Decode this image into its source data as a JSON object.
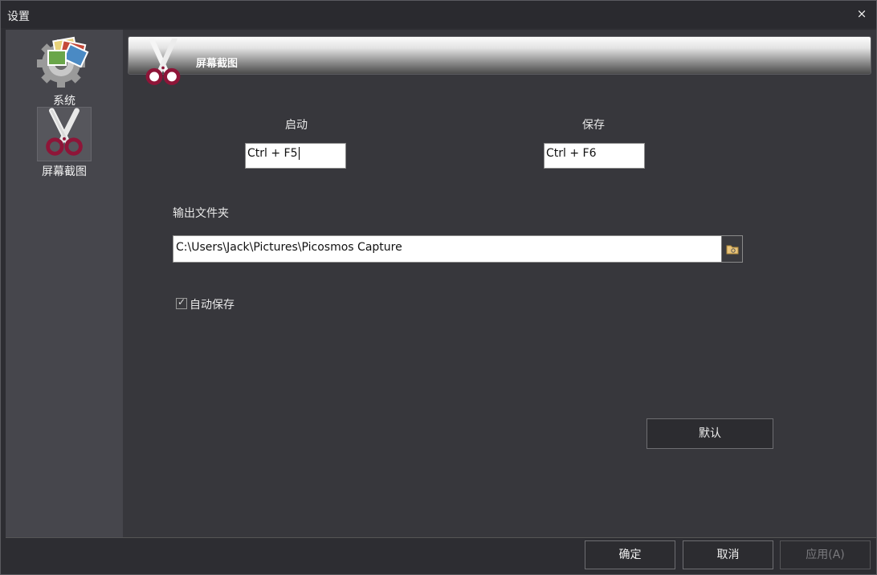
{
  "window": {
    "title": "设置",
    "close_icon": "×"
  },
  "sidebar": {
    "items": [
      {
        "label": "系统",
        "icon": "gear-photos-icon",
        "active": false
      },
      {
        "label": "屏幕截图",
        "icon": "scissors-icon",
        "active": true
      }
    ]
  },
  "header": {
    "title": "屏幕截图",
    "icon": "scissors-icon"
  },
  "hotkeys": {
    "start_label": "启动",
    "start_value": "Ctrl + F5",
    "save_label": "保存",
    "save_value": "Ctrl + F6"
  },
  "output": {
    "label": "输出文件夹",
    "path": "C:\\Users\\Jack\\Pictures\\Picosmos Capture",
    "browse_icon": "folder-icon"
  },
  "auto_save": {
    "label": "自动保存",
    "checked": true
  },
  "buttons": {
    "default": "默认",
    "ok": "确定",
    "cancel": "取消",
    "apply": "应用(A)"
  },
  "colors": {
    "background": "#37373c",
    "sidebar": "#46464c",
    "accent": "#8e1538"
  }
}
